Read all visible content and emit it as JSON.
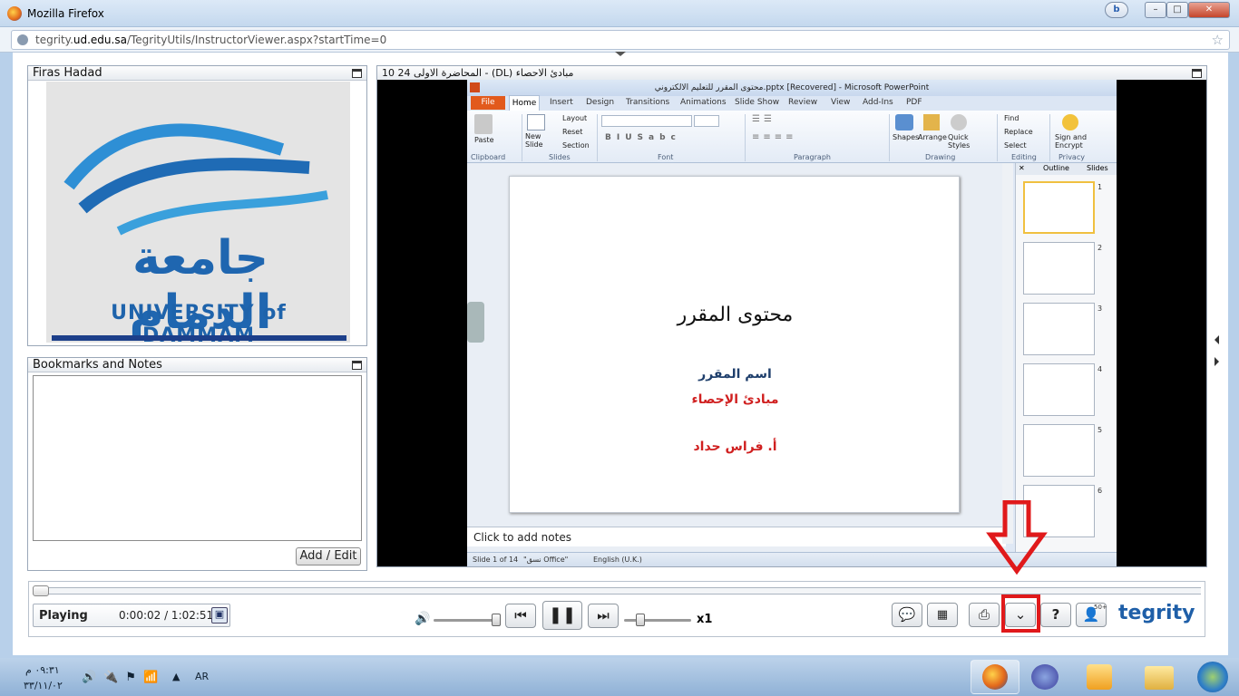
{
  "window": {
    "title": "Mozilla Firefox"
  },
  "address": {
    "host_pre": "tegrity.",
    "host_bold": "ud.edu.sa",
    "path": "/TegrityUtils/InstructorViewer.aspx?startTime=0"
  },
  "presenter_panel": {
    "title": "Firas Hadad"
  },
  "logo": {
    "arabic": "جامعة الدمام",
    "english": "UNIVERSITY of DAMMAM"
  },
  "notes_panel": {
    "title": "Bookmarks and Notes",
    "add_edit": "Add / Edit"
  },
  "video_panel": {
    "title": "المحاضرة الاولى 24 10 - (DL) مبادئ الاحصاء"
  },
  "ppt": {
    "title": "محتوى المقرر للتعليم الالكتروني.pptx [Recovered]  -  Microsoft PowerPoint",
    "tabs": [
      "File",
      "Home",
      "Insert",
      "Design",
      "Transitions",
      "Animations",
      "Slide Show",
      "Review",
      "View",
      "Add-Ins",
      "PDF"
    ],
    "groups": {
      "clipboard": "Clipboard",
      "slides": "Slides",
      "font": "Font",
      "paragraph": "Paragraph",
      "drawing": "Drawing",
      "editing": "Editing",
      "privacy": "Privacy"
    },
    "buttons": {
      "paste": "Paste",
      "new_slide": "New Slide",
      "layout": "Layout",
      "reset": "Reset",
      "section": "Section",
      "shapes": "Shapes",
      "arrange": "Arrange",
      "quick_styles": "Quick Styles",
      "find": "Find",
      "replace": "Replace",
      "select": "Select",
      "sign": "Sign and Encrypt"
    },
    "slide": {
      "title": "محتوى المقرر",
      "line1": "اسم المقرر",
      "line2": "مبادئ الإحصاء",
      "line3": "أ. فراس حداد"
    },
    "notes_placeholder": "Click to add notes",
    "thumb_tabs": {
      "outline": "Outline",
      "slides": "Slides"
    },
    "thumb_numbers": [
      "1",
      "2",
      "3",
      "4",
      "5",
      "6"
    ],
    "status": {
      "slide": "Slide 1 of 14",
      "theme": "\"نسق Office\"",
      "lang": "English (U.K.)"
    }
  },
  "player": {
    "state": "Playing",
    "time": "0:00:02 / 1:02:51",
    "speed": "x1",
    "brand": "tegrity",
    "users_badge": "50+"
  },
  "taskbar": {
    "time": "٠٩:٣١ م",
    "date": "٣٣/١١/٠٢",
    "lang": "AR"
  }
}
